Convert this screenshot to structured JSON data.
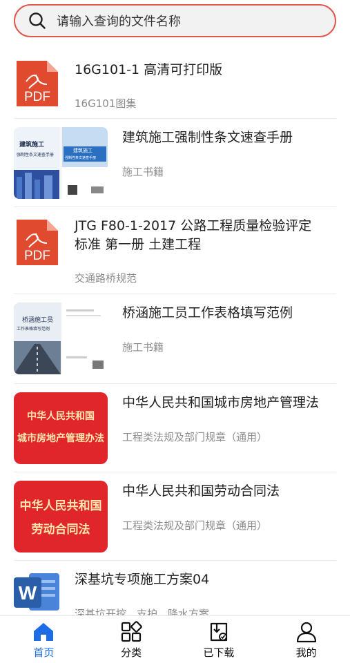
{
  "search": {
    "placeholder": "请输入查询的文件名称",
    "icon": "search-icon"
  },
  "colors": {
    "accent": "#1e6de6",
    "search_border": "#e0574f",
    "pdf_red": "#e04a2f",
    "cover_red": "#e0252b",
    "word_blue": "#2b5ea8"
  },
  "items": [
    {
      "title": "16G101-1 高清可打印版",
      "category": "16G101图集",
      "thumb": "pdf-icon"
    },
    {
      "title": "建筑施工强制性条文速查手册",
      "category": "施工书籍",
      "thumb": "book-cover",
      "cover": {
        "left_title": "建筑施工",
        "left_subtitle": "强制性条文速查手册",
        "right_title": "建筑施工",
        "right_subtitle": "强制性条文速查手册"
      }
    },
    {
      "title_line1": "JTG F80-1-2017 公路工程质量检验评定",
      "title_line2": "标准 第一册 土建工程",
      "category": "交通路桥规范",
      "thumb": "pdf-icon"
    },
    {
      "title": "桥涵施工员工作表格填写范例",
      "category": "施工书籍",
      "thumb": "book-cover",
      "cover": {
        "title": "桥涵施工员",
        "subtitle": "工作表格填写范例"
      }
    },
    {
      "title": "中华人民共和国城市房地产管理法",
      "category": "工程类法规及部门规章（通用）",
      "thumb": "red-cover",
      "cover": {
        "line1": "中华人民共和国",
        "line2": "城市房地产管理办法"
      }
    },
    {
      "title": "中华人民共和国劳动合同法",
      "category": "工程类法规及部门规章（通用）",
      "thumb": "red-cover",
      "cover": {
        "line1": "中华人民共和国",
        "line2": "劳动合同法"
      }
    },
    {
      "title": "深基坑专项施工方案04",
      "category": "深基坑开挖、支护、降水方案",
      "thumb": "word-icon"
    }
  ],
  "pdf_label": "PDF",
  "tabs": [
    {
      "label": "首页",
      "icon": "home-icon",
      "active": true
    },
    {
      "label": "分类",
      "icon": "category-grid-icon",
      "active": false
    },
    {
      "label": "已下载",
      "icon": "downloaded-icon",
      "active": false
    },
    {
      "label": "我的",
      "icon": "user-icon",
      "active": false
    }
  ]
}
